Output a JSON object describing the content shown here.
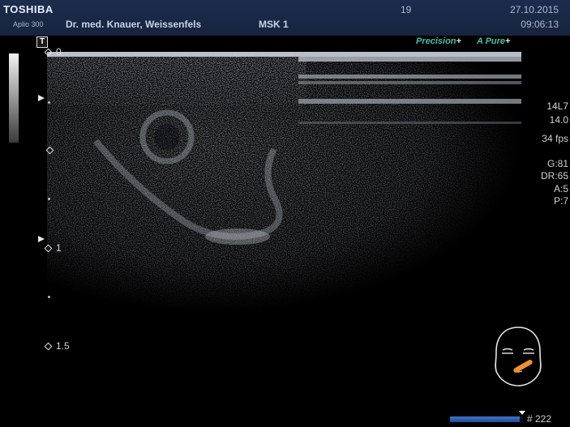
{
  "header": {
    "brand": "TOSHIBA",
    "model": "Aplio 300",
    "doctor": "Dr. med. Knauer, Weissenfels",
    "preset": "MSK 1",
    "frame_no": "19",
    "date": "27.10.2015",
    "time": "09:06:13"
  },
  "t_marker": "T",
  "depth_scale": {
    "top": "0",
    "mid": "1",
    "bottom": "1.5"
  },
  "imaging_modes": {
    "precision": "Precision",
    "apure": "A Pure",
    "plus": "+"
  },
  "params": {
    "transducer": "14L7",
    "frequency": "14.0",
    "fps": "34 fps",
    "gain": "G:81",
    "dynamic_range": "DR:65",
    "a": "A:5",
    "p": "P:7"
  },
  "cine": {
    "position": 0.96,
    "frame_count": "# 222"
  },
  "icons": [
    "t-marker-icon",
    "focus-marker-icon",
    "head-pictogram-icon",
    "probe-marker-icon"
  ]
}
